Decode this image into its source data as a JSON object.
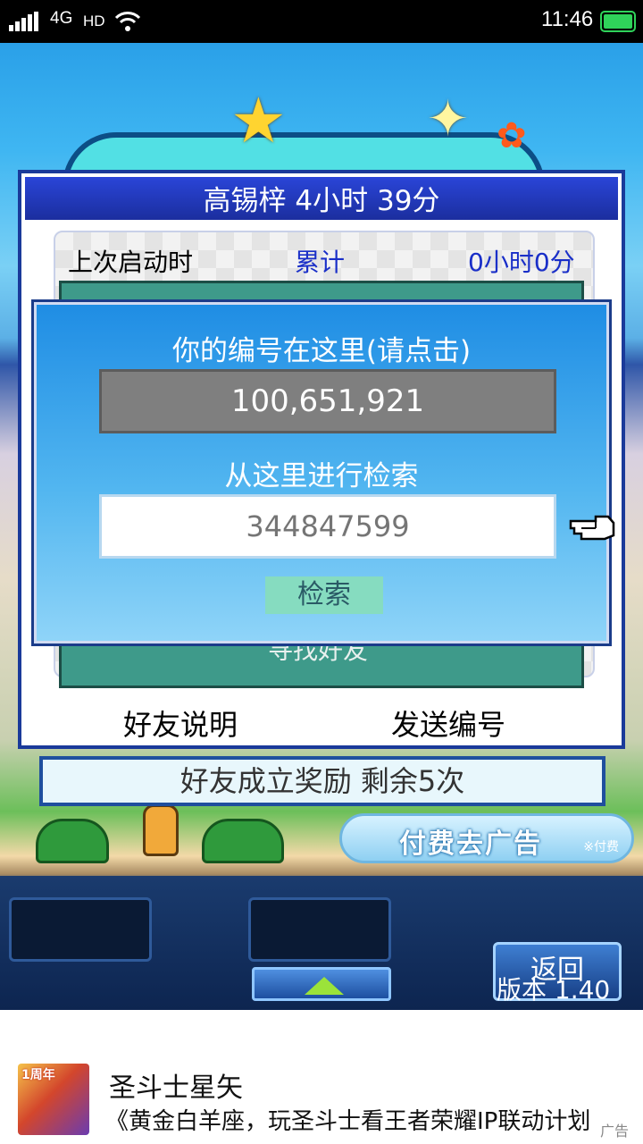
{
  "status_bar": {
    "network": "4G",
    "hd": "HD",
    "time": "11:46",
    "battery_color": "#2fd35a"
  },
  "friends_dialog": {
    "title": "高锡梓  4小时 39分",
    "stats": {
      "last_launch_label": "上次启动时",
      "total_label": "累计",
      "total_value": "0小时0分"
    },
    "hidden_button": "寻找好友",
    "help_button": "好友说明",
    "send_id_button": "发送编号"
  },
  "search_overlay": {
    "id_heading": "你的编号在这里(请点击)",
    "my_id": "100,651,921",
    "search_heading": "从这里进行检索",
    "search_placeholder": "344847599",
    "search_button": "检索"
  },
  "reward_bar": "好友成立奖励  剩余5次",
  "ad_banner": {
    "text": "付费去广告",
    "sub": "※付费"
  },
  "bottom_panel": {
    "back_button": "返回",
    "version": "版本 1.40"
  },
  "ad": {
    "thumb_text": "1周年",
    "title": "圣斗士星矢",
    "description": "《黄金白羊座，玩圣斗士看王者荣耀IP联动计划",
    "tag": "广告"
  },
  "icons": [
    "signal-icon",
    "wifi-icon",
    "battery-icon",
    "star-icon",
    "flower-icon",
    "pointing-hand-icon",
    "up-arrow-icon"
  ]
}
